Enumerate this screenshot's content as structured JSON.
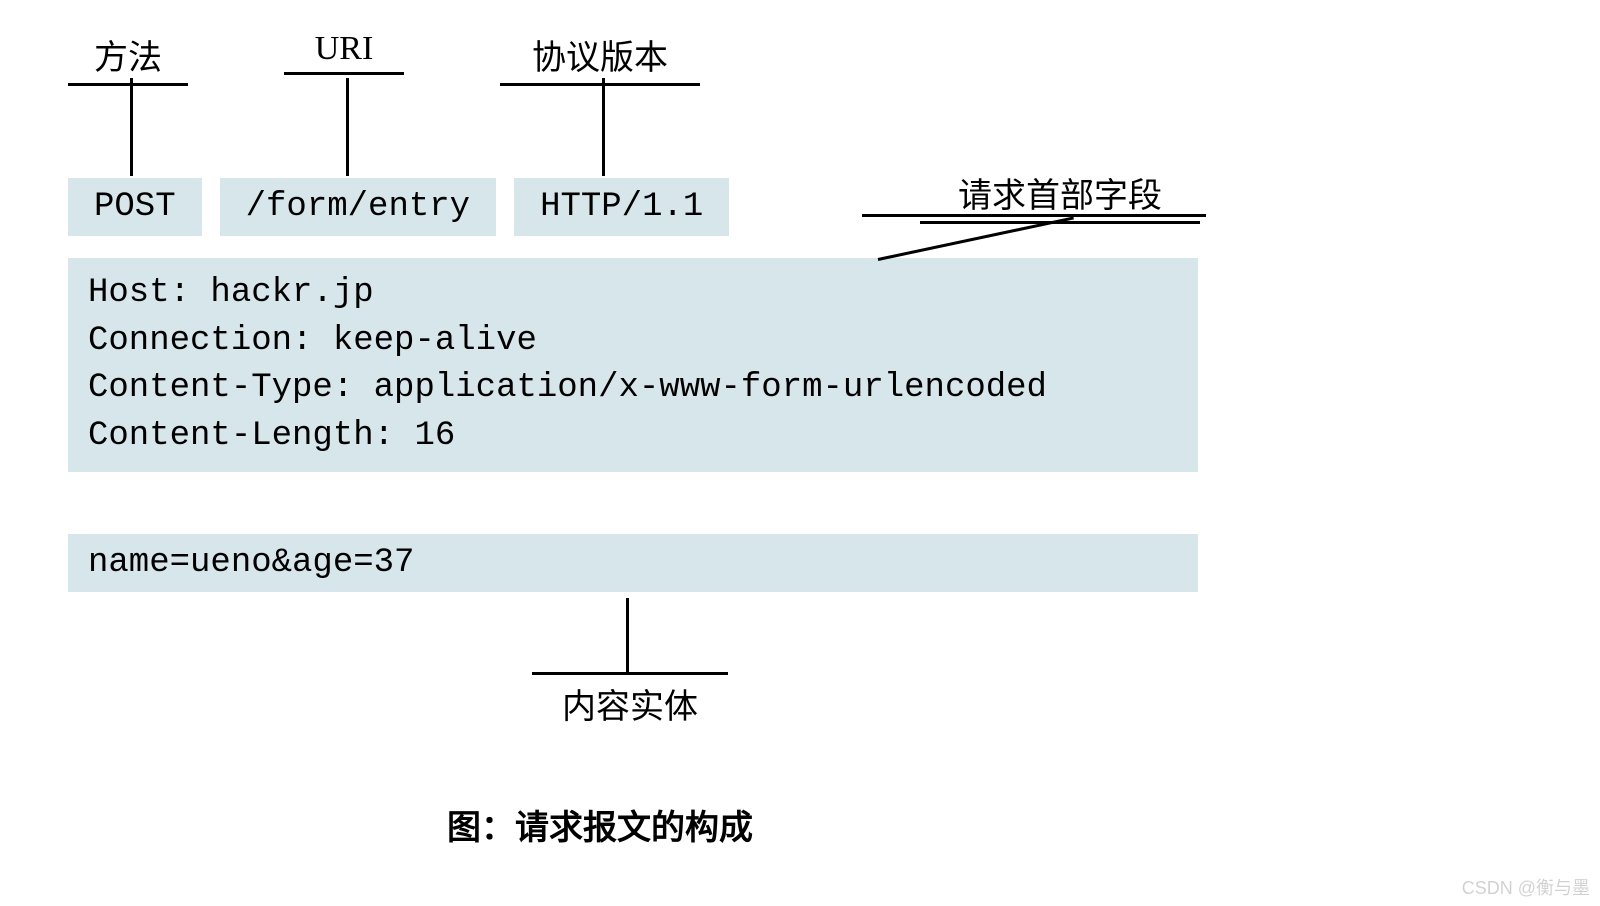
{
  "labels": {
    "method": "方法",
    "uri": "URI",
    "version": "协议版本",
    "headers": "请求首部字段",
    "body": "内容实体"
  },
  "request_line": {
    "method": "POST",
    "uri": "/form/entry",
    "version": "HTTP/1.1"
  },
  "headers": [
    "Host: hackr.jp",
    "Connection: keep-alive",
    "Content-Type: application/x-www-form-urlencoded",
    "Content-Length: 16"
  ],
  "body": "name=ueno&age=37",
  "caption": "图：请求报文的构成",
  "watermark": "CSDN @衡与墨"
}
